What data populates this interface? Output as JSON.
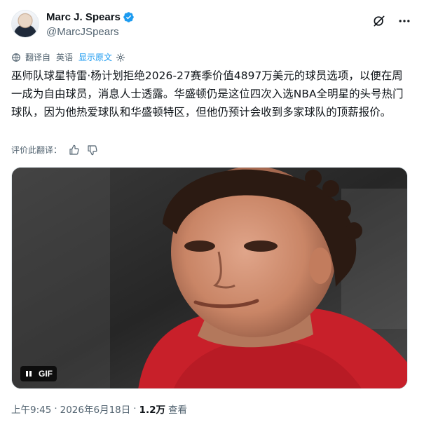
{
  "author": {
    "display_name": "Marc J. Spears",
    "handle": "@MarcJSpears"
  },
  "icons": {
    "verified": "verified-badge-icon",
    "grok": "grok-icon",
    "more": "more-icon",
    "translate": "translate-icon",
    "settings": "gear-icon",
    "thumbs_up": "thumbs-up-icon",
    "thumbs_down": "thumbs-down-icon",
    "pause": "pause-icon"
  },
  "translation": {
    "label": "翻译自",
    "language": "英语",
    "show_original": "显示原文"
  },
  "tweet": {
    "text": "巫师队球星特雷·杨计划拒绝2026-27赛季价值4897万美元的球员选项，以便在周一成为自由球员，消息人士透露。华盛顿仍是这位四次入选NBA全明星的头号热门球队，因为他热爱球队和华盛顿特区，但他仍预计会收到多家球队的顶薪报价。"
  },
  "rate": {
    "label": "评价此翻译："
  },
  "media": {
    "badge": "GIF"
  },
  "meta": {
    "time": "上午9:45",
    "separator": "·",
    "date": "2026年6月18日",
    "views_count": "1.2万",
    "views_label": "查看"
  },
  "colors": {
    "accent": "#1d9bf0",
    "text": "#0f1419",
    "secondary": "#536471",
    "jersey": "#c8202a"
  }
}
